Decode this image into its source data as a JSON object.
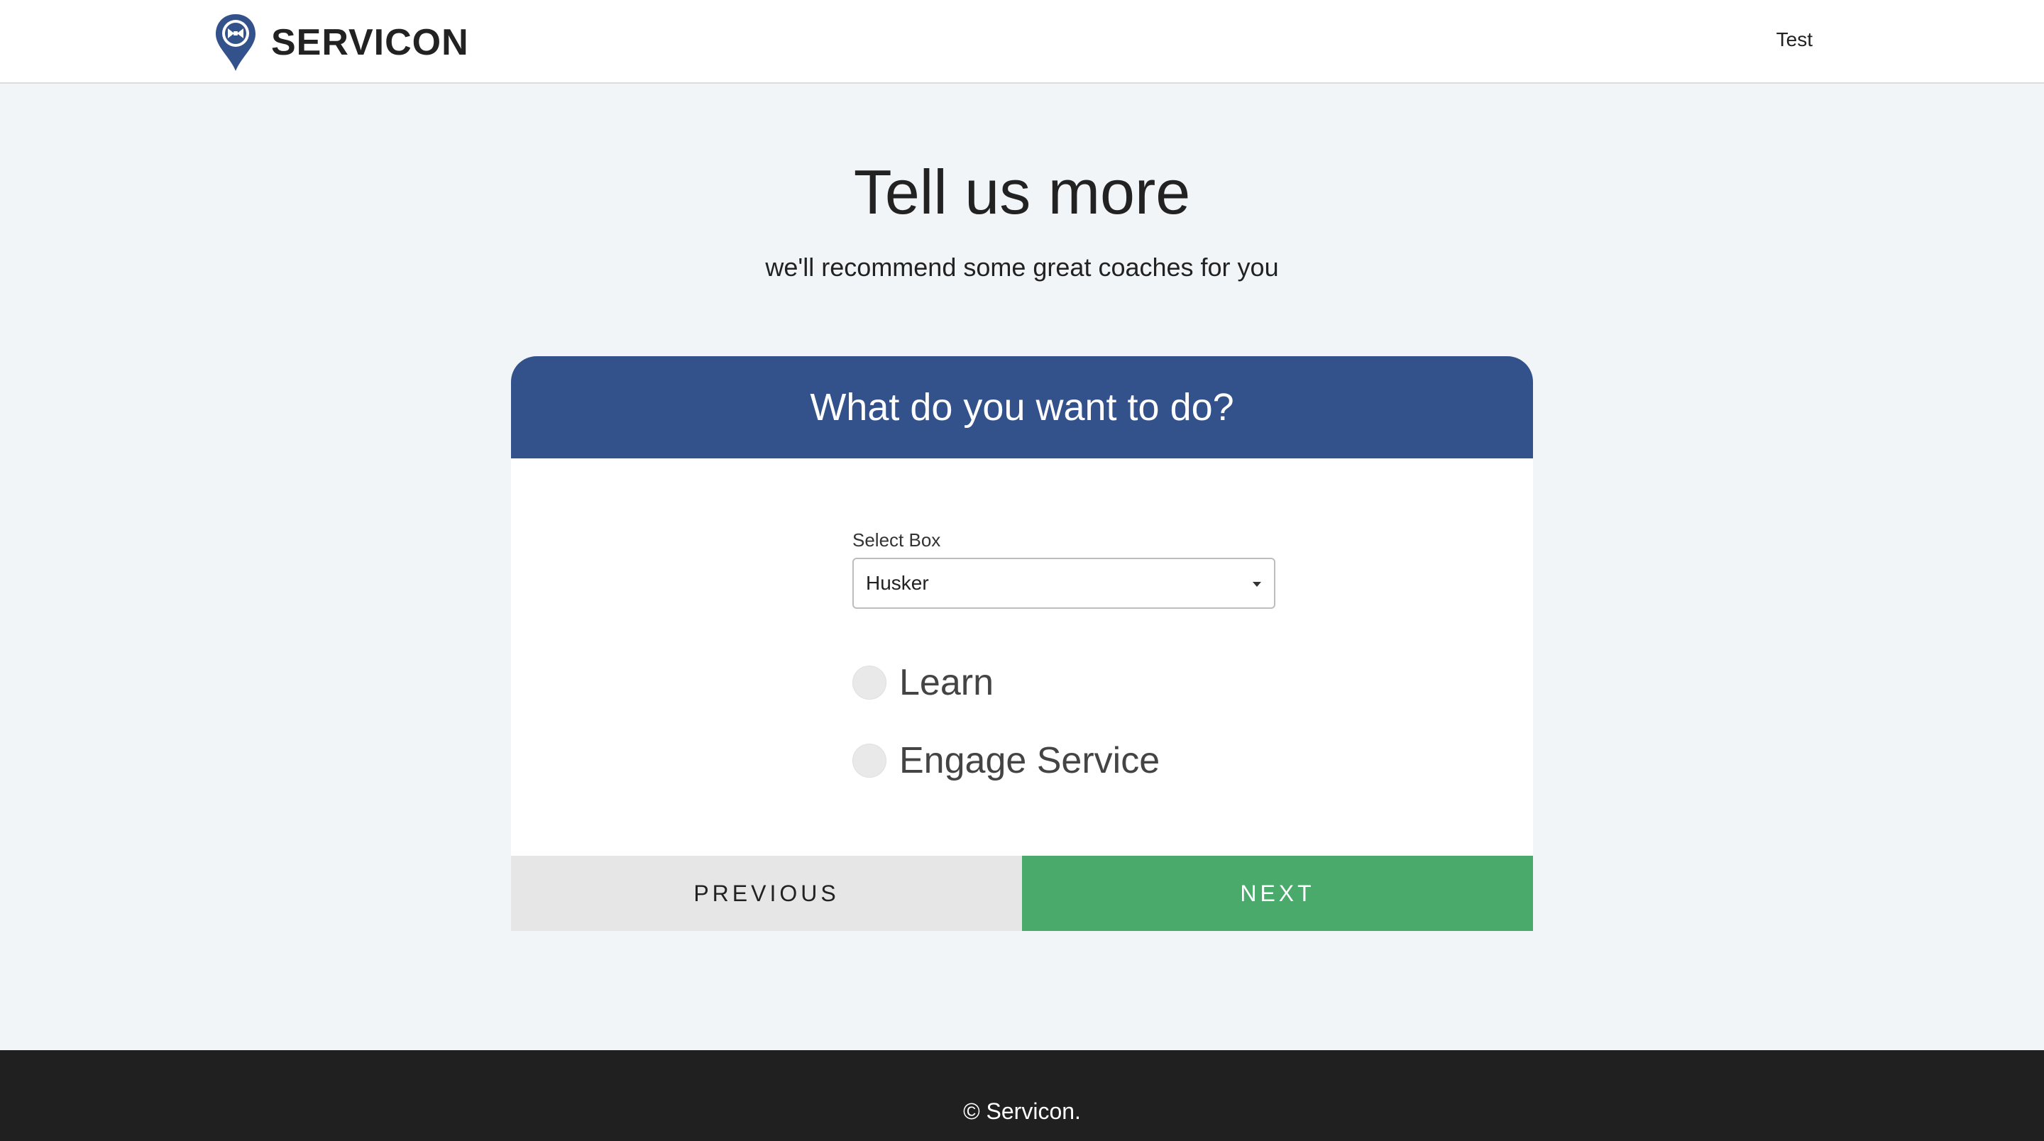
{
  "header": {
    "brand": "SERVICON",
    "logo_icon": "map-pin-bowtie-icon",
    "user_label": "Test"
  },
  "hero": {
    "title": "Tell us more",
    "subtitle": "we'll recommend some great coaches for you"
  },
  "card": {
    "heading": "What do you want to do?",
    "select": {
      "label": "Select Box",
      "value": "Husker"
    },
    "options": [
      {
        "label": "Learn",
        "checked": false
      },
      {
        "label": "Engage Service",
        "checked": false
      }
    ],
    "buttons": {
      "previous": "PREVIOUS",
      "next": "NEXT"
    }
  },
  "footer": {
    "text": "© Servicon."
  },
  "colors": {
    "brand_blue": "#33528b",
    "next_green": "#4aaa6c",
    "page_background": "#f1f5f8",
    "footer_background": "#202020"
  }
}
